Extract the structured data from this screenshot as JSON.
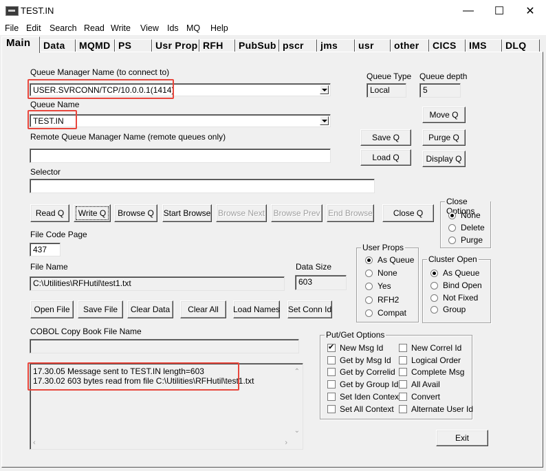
{
  "window": {
    "title": "TEST.IN",
    "minimize": "—",
    "maximize": "☐",
    "close": "✕"
  },
  "menu": [
    "File",
    "Edit",
    "Search",
    "Read",
    "Write",
    "View",
    "Ids",
    "MQ",
    "Help"
  ],
  "tabs": [
    "Main",
    "Data",
    "MQMD",
    "PS",
    "Usr Prop",
    "RFH",
    "PubSub",
    "pscr",
    "jms",
    "usr",
    "other",
    "CICS",
    "IMS",
    "DLQ"
  ],
  "main": {
    "qmgr_label": "Queue Manager Name (to connect to)",
    "qmgr_value": "USER.SVRCONN/TCP/10.0.0.1(1414)",
    "queue_label": "Queue Name",
    "queue_value": "TEST.IN",
    "remote_qmgr_label": "Remote Queue Manager Name (remote queues only)",
    "remote_qmgr_value": "",
    "selector_label": "Selector",
    "selector_value": "",
    "queue_type_label": "Queue Type",
    "queue_type_value": "Local",
    "queue_depth_label": "Queue depth",
    "queue_depth_value": "5",
    "code_page_label": "File Code Page",
    "code_page_value": "437",
    "file_name_label": "File Name",
    "file_name_value": "C:\\Utilities\\RFHutil\\test1.txt",
    "data_size_label": "Data Size",
    "data_size_value": "603",
    "cobol_label": "COBOL Copy Book File Name",
    "cobol_value": ""
  },
  "buttons": {
    "move_q": "Move Q",
    "save_q": "Save Q",
    "purge_q": "Purge Q",
    "load_q": "Load Q",
    "display_q": "Display Q",
    "read_q": "Read Q",
    "write_q": "Write Q",
    "browse_q": "Browse Q",
    "start_browse": "Start Browse",
    "browse_next": "Browse Next",
    "browse_prev": "Browse Prev",
    "end_browse": "End Browse",
    "close_q": "Close Q",
    "open_file": "Open File",
    "save_file": "Save File",
    "clear_data": "Clear Data",
    "clear_all": "Clear All",
    "load_names": "Load Names",
    "set_conn_id": "Set Conn Id",
    "exit": "Exit"
  },
  "close_options": {
    "title": "Close Options",
    "items": [
      "None",
      "Delete",
      "Purge"
    ],
    "selected": "None"
  },
  "user_props": {
    "title": "User Props",
    "items": [
      "As Queue",
      "None",
      "Yes",
      "RFH2",
      "Compat"
    ],
    "selected": "As Queue"
  },
  "cluster_open": {
    "title": "Cluster Open",
    "items": [
      "As Queue",
      "Bind Open",
      "Not Fixed",
      "Group"
    ],
    "selected": "As Queue"
  },
  "put_get": {
    "title": "Put/Get Options",
    "left": [
      {
        "label": "New Msg Id",
        "checked": true
      },
      {
        "label": "Get by Msg Id",
        "checked": false
      },
      {
        "label": "Get by Correlid",
        "checked": false
      },
      {
        "label": "Get by Group Id",
        "checked": false
      },
      {
        "label": "Set Iden Context",
        "checked": false
      },
      {
        "label": "Set All Context",
        "checked": false
      }
    ],
    "right": [
      {
        "label": "New Correl Id",
        "checked": false
      },
      {
        "label": "Logical Order",
        "checked": false
      },
      {
        "label": "Complete Msg",
        "checked": false
      },
      {
        "label": "All Avail",
        "checked": false
      },
      {
        "label": "Convert",
        "checked": false
      },
      {
        "label": "Alternate User Id",
        "checked": false
      }
    ]
  },
  "log": [
    "17.30.05 Message sent to TEST.IN length=603",
    "17.30.02 603 bytes read from file C:\\Utilities\\RFHutil\\test1.txt"
  ],
  "colors": {
    "highlight": "#e8463c",
    "face": "#f0f0f0"
  }
}
